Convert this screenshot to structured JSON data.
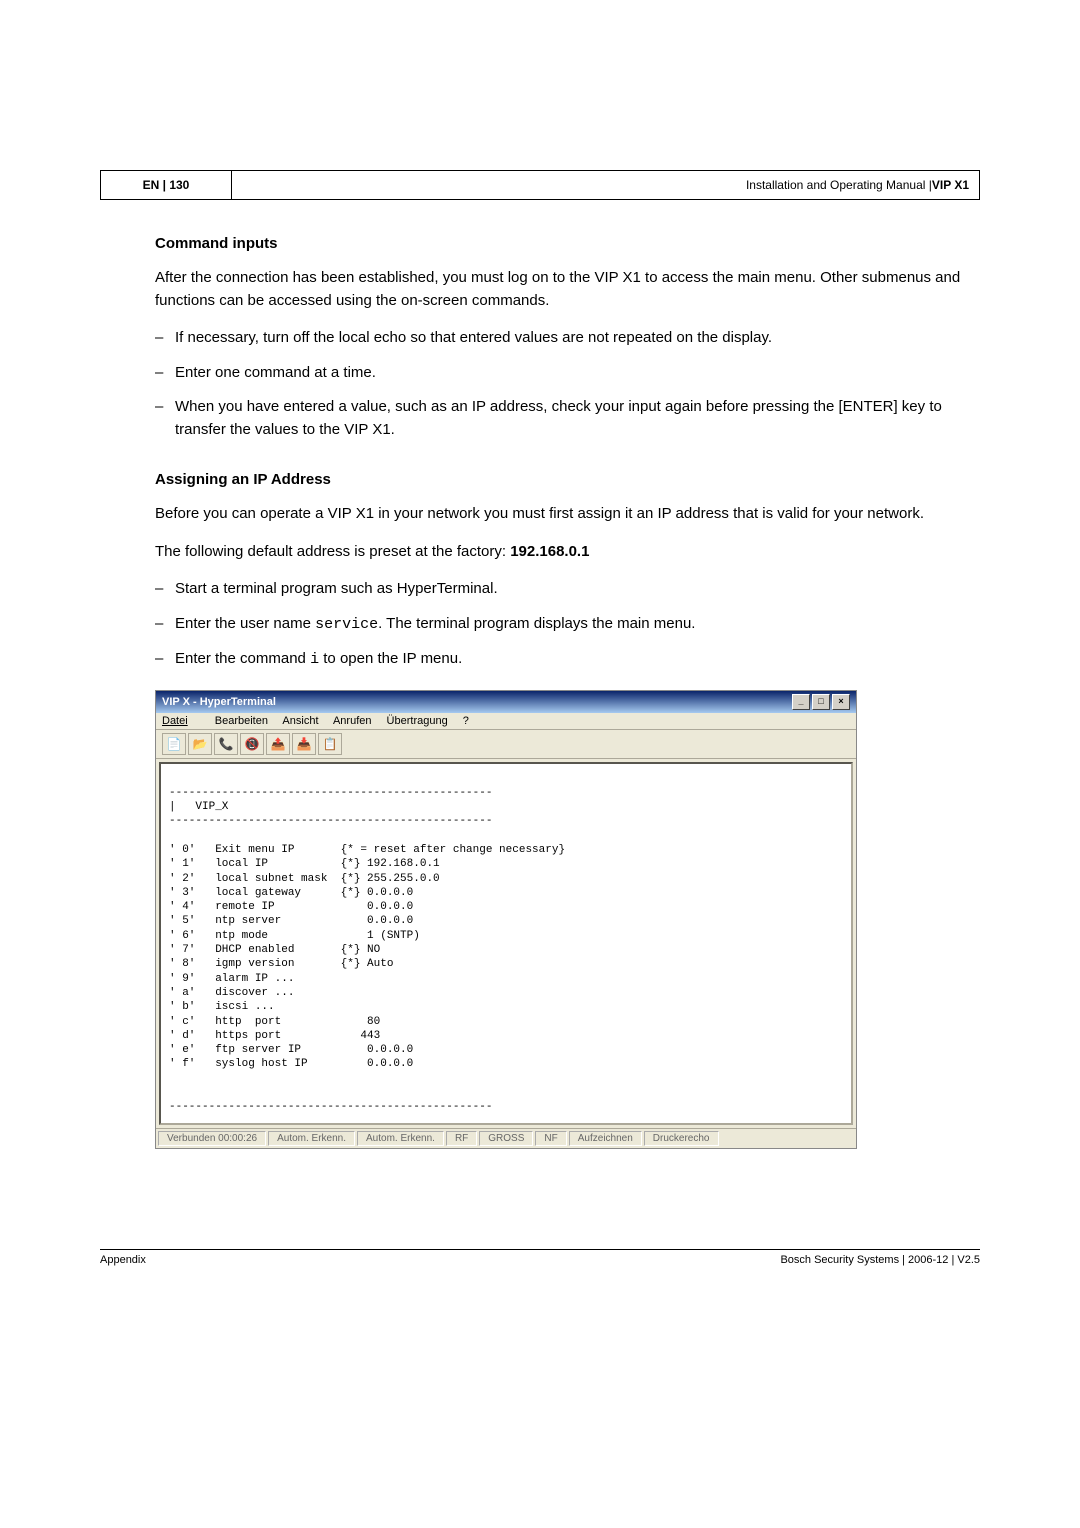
{
  "header": {
    "left": "EN | 130",
    "right_prefix": "Installation and Operating Manual | ",
    "right_bold": "VIP X1"
  },
  "section1": {
    "title": "Command inputs",
    "para": "After the connection has been established, you must log on to the VIP X1 to access the main menu. Other submenus and functions can be accessed using the on-screen commands.",
    "bullets": [
      "If necessary, turn off the local echo so that entered values are not repeated on the display.",
      "Enter one command at a time.",
      "When you have entered a value, such as an IP address, check your input again before pressing the [ENTER] key to transfer the values to the VIP X1."
    ]
  },
  "section2": {
    "title": "Assigning an IP Address",
    "para1": "Before you can operate a VIP X1 in your network you must first assign it an IP address that is valid for your network.",
    "para2_prefix": "The following default address is preset at the factory: ",
    "para2_bold": "192.168.0.1",
    "bullets": [
      {
        "text": "Start a terminal program such as HyperTerminal."
      },
      {
        "prefix": "Enter the user name ",
        "mono": "service",
        "suffix": ". The terminal program displays the main menu."
      },
      {
        "prefix": "Enter the command ",
        "mono": "i",
        "suffix": " to open the IP menu."
      }
    ]
  },
  "terminal": {
    "title": "VIP X - HyperTerminal",
    "menu": [
      "Datei",
      "Bearbeiten",
      "Ansicht",
      "Anrufen",
      "Übertragung",
      "?"
    ],
    "body": "\n-------------------------------------------------\n|   VIP_X\n-------------------------------------------------\n\n' 0'   Exit menu IP       {* = reset after change necessary}\n' 1'   local IP           {*} 192.168.0.1\n' 2'   local subnet mask  {*} 255.255.0.0\n' 3'   local gateway      {*} 0.0.0.0\n' 4'   remote IP              0.0.0.0\n' 5'   ntp server             0.0.0.0\n' 6'   ntp mode               1 (SNTP)\n' 7'   DHCP enabled       {*} NO\n' 8'   igmp version       {*} Auto\n' 9'   alarm IP ...\n' a'   discover ...\n' b'   iscsi ...\n' c'   http  port             80\n' d'   https port            443\n' e'   ftp server IP          0.0.0.0\n' f'   syslog host IP         0.0.0.0\n\n\n-------------------------------------------------\n",
    "status": [
      "Verbunden 00:00:26",
      "Autom. Erkenn.",
      "Autom. Erkenn.",
      "RF",
      "GROSS",
      "NF",
      "Aufzeichnen",
      "Druckerecho"
    ]
  },
  "footer": {
    "left": "Appendix",
    "right": "Bosch Security Systems | 2006-12 | V2.5"
  },
  "icons": {
    "min": "_",
    "max": "□",
    "close": "×"
  }
}
